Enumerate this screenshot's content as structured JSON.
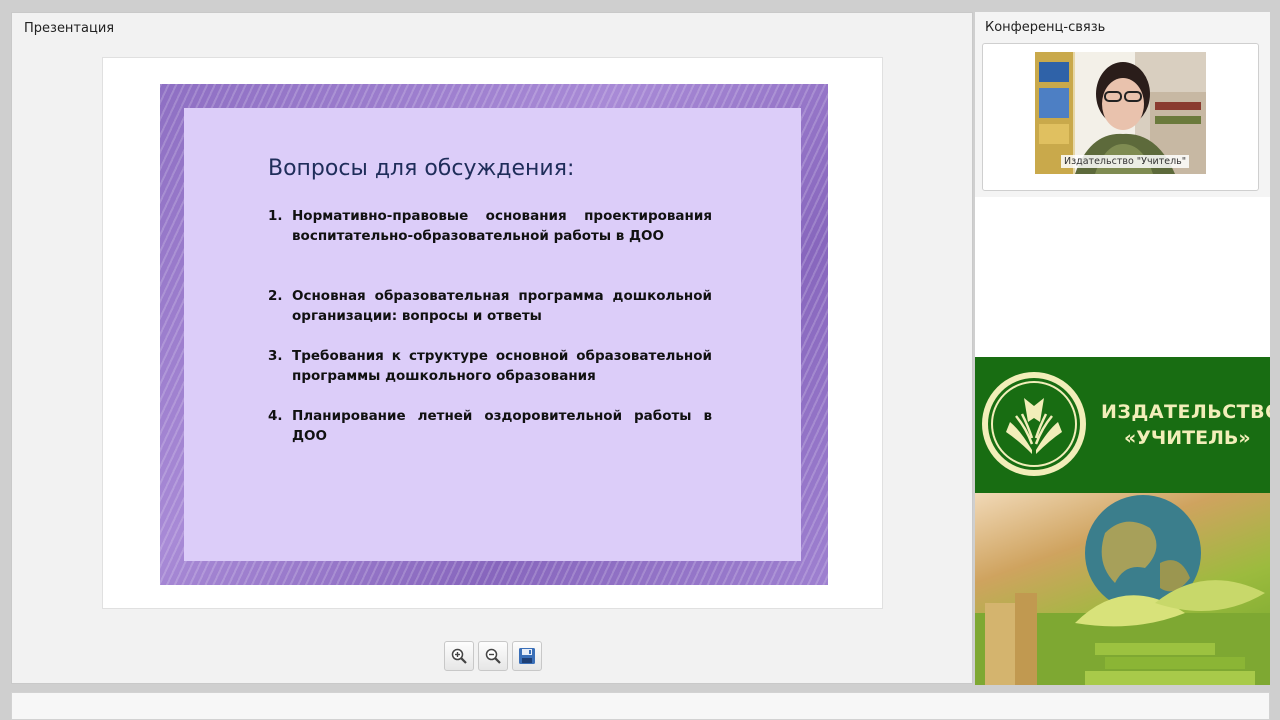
{
  "presentation": {
    "title": "Презентация",
    "slide": {
      "heading": "Вопросы для обсуждения:",
      "items": [
        {
          "num": "1.",
          "text": "Нормативно-правовые основания проектирования воспитательно-образовательной работы в ДОО"
        },
        {
          "num": "2.",
          "text": "Основная образовательная программа дошкольной организации: вопросы и ответы"
        },
        {
          "num": "3.",
          "text": "Требования к структуре основной образовательной программы дошкольного образования"
        },
        {
          "num": "4.",
          "text": "Планирование летней оздоровительной работы в ДОО"
        }
      ]
    },
    "toolbar": {
      "zoom_in_icon": "zoom-in-icon",
      "zoom_out_icon": "zoom-out-icon",
      "save_icon": "save-icon"
    }
  },
  "conference": {
    "title": "Конференц-связь",
    "participant_name": "Издательство \"Учитель\""
  },
  "ad": {
    "line1": "ИЗДАТЕЛЬСТВО",
    "line2": "«УЧИТЕЛЬ»"
  },
  "colors": {
    "slide_bg": "#dccdf9",
    "slide_frame": "#9a7ccd",
    "ad_green": "#186d12",
    "ad_text": "#f2eeb9"
  }
}
